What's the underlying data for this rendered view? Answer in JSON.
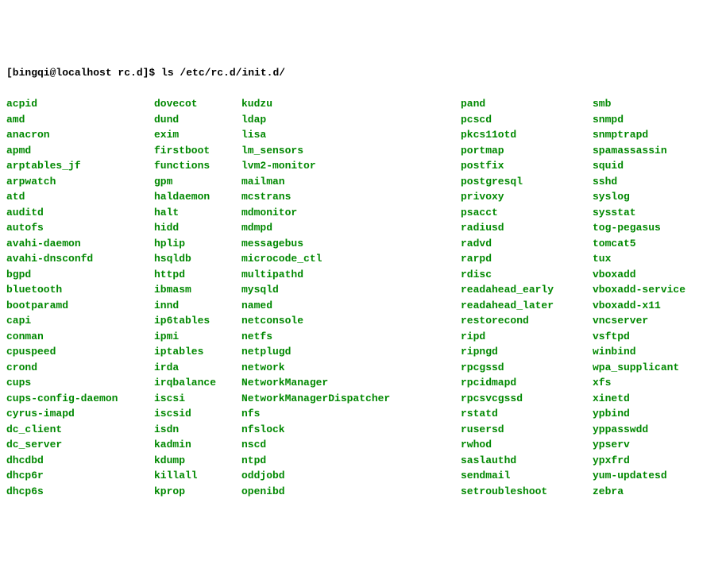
{
  "prompt": "[bingqi@localhost rc.d]$ ls /etc/rc.d/init.d/",
  "columns": [
    [
      "acpid",
      "amd",
      "anacron",
      "apmd",
      "arptables_jf",
      "arpwatch",
      "atd",
      "auditd",
      "autofs",
      "avahi-daemon",
      "avahi-dnsconfd",
      "bgpd",
      "bluetooth",
      "bootparamd",
      "capi",
      "conman",
      "cpuspeed",
      "crond",
      "cups",
      "cups-config-daemon",
      "cyrus-imapd",
      "dc_client",
      "dc_server",
      "dhcdbd",
      "dhcp6r",
      "dhcp6s"
    ],
    [
      "dovecot",
      "dund",
      "exim",
      "firstboot",
      "functions",
      "gpm",
      "haldaemon",
      "halt",
      "hidd",
      "hplip",
      "hsqldb",
      "httpd",
      "ibmasm",
      "innd",
      "ip6tables",
      "ipmi",
      "iptables",
      "irda",
      "irqbalance",
      "iscsi",
      "iscsid",
      "isdn",
      "kadmin",
      "kdump",
      "killall",
      "kprop"
    ],
    [
      "kudzu",
      "ldap",
      "lisa",
      "lm_sensors",
      "lvm2-monitor",
      "mailman",
      "mcstrans",
      "mdmonitor",
      "mdmpd",
      "messagebus",
      "microcode_ctl",
      "multipathd",
      "mysqld",
      "named",
      "netconsole",
      "netfs",
      "netplugd",
      "network",
      "NetworkManager",
      "NetworkManagerDispatcher",
      "nfs",
      "nfslock",
      "nscd",
      "ntpd",
      "oddjobd",
      "openibd"
    ],
    [
      "pand",
      "pcscd",
      "pkcs11otd",
      "portmap",
      "postfix",
      "postgresql",
      "privoxy",
      "psacct",
      "radiusd",
      "radvd",
      "rarpd",
      "rdisc",
      "readahead_early",
      "readahead_later",
      "restorecond",
      "ripd",
      "ripngd",
      "rpcgssd",
      "rpcidmapd",
      "rpcsvcgssd",
      "rstatd",
      "rusersd",
      "rwhod",
      "saslauthd",
      "sendmail",
      "setroubleshoot"
    ],
    [
      "smb",
      "snmpd",
      "snmptrapd",
      "spamassassin",
      "squid",
      "sshd",
      "syslog",
      "sysstat",
      "tog-pegasus",
      "tomcat5",
      "tux",
      "vboxadd",
      "vboxadd-service",
      "vboxadd-x11",
      "vncserver",
      "vsftpd",
      "winbind",
      "wpa_supplicant",
      "xfs",
      "xinetd",
      "ypbind",
      "yppasswdd",
      "ypserv",
      "ypxfrd",
      "yum-updatesd",
      "zebra"
    ]
  ]
}
